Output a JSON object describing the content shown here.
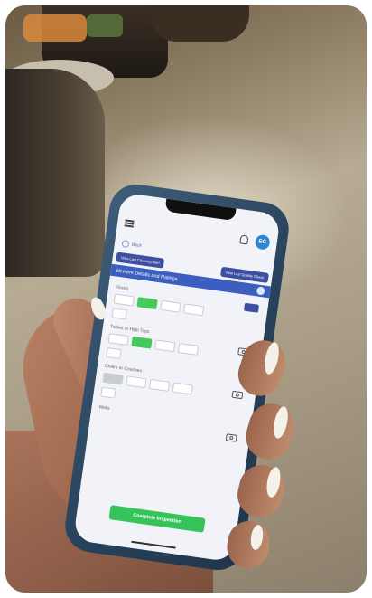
{
  "phone": {
    "back_label": "Back",
    "button_left": "View Last Cleaning Alert",
    "button_right": "View Last Quality Check",
    "section_title": "Element Details and Ratings",
    "fields": [
      {
        "label": "Floors"
      },
      {
        "label": "Tables or High Tops"
      },
      {
        "label": "Chairs or Couches"
      },
      {
        "label": "Walls"
      }
    ],
    "avatar_initials": "EG",
    "complete_button": "Complete Inspection"
  },
  "colors": {
    "accent": "#3c5fbf",
    "selected_rating": "#47c85a",
    "complete_button": "#36c35a",
    "phone_case": "#2f4a66"
  }
}
